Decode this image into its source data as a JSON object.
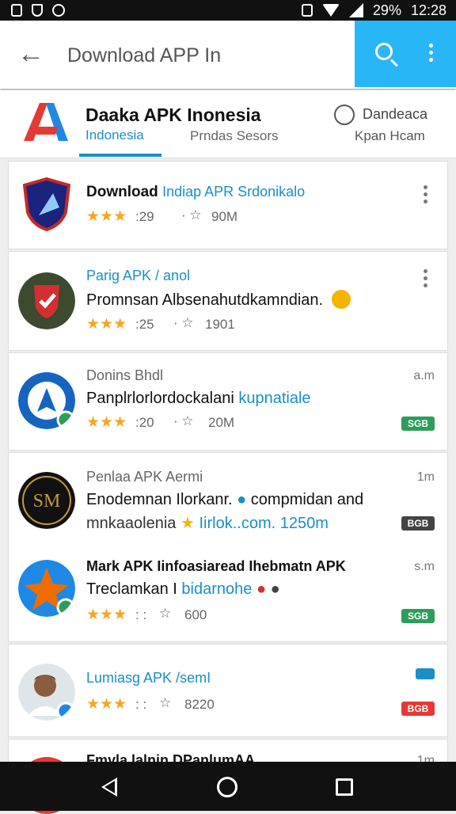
{
  "status_bar": {
    "battery": "29%",
    "time": "12:28"
  },
  "toolbar": {
    "search_text": "Download APP In",
    "back_icon": "arrow-left-icon",
    "search_icon": "search-icon",
    "menu_icon": "more-vert-icon",
    "accent": "#29b6f6"
  },
  "header": {
    "title": "Daaka APK Inonesia",
    "tab_active": "Indonesia",
    "tab_mid": "Prndas Sesors",
    "right_line1": "Dandeaca",
    "right_line2": "Kpan Hcam",
    "accent": "#1a8fc4"
  },
  "apps": [
    {
      "title_bold": "Download",
      "title_rest": "Indiap APR Srdonikalo",
      "stars": "★★★",
      "rating": ":29",
      "downloads": "90M"
    },
    {
      "title": "Parig APK / anol",
      "line": "Promnsan Albsenahutdkamndian.",
      "stars": "★★★",
      "rating": ":25",
      "downloads": "1901"
    },
    {
      "title": "Donins Bhdl",
      "line_a": "Panplrlorlordockalani",
      "line_b": "kupnatiale",
      "stars": "★★★",
      "rating": ":20",
      "downloads": "20M",
      "note": "a.m",
      "badge": "SGB"
    },
    {
      "title": "Penlaa APK Aermi",
      "line1": "Enodemnan Ilorkanr.",
      "line1b": "compmidan and",
      "line2": "mnkaaolenia",
      "line2b": "Iirlok..com.",
      "line2c": "1250m",
      "note": "1m",
      "badge": "BGB"
    },
    {
      "title": "Mark APK Iinfoasiaread Ihebmatn APK",
      "line": "Treclamkan I",
      "line_b": "bidarnohe",
      "stars": "★★★",
      "rating": ": :",
      "downloads": "600",
      "note": "s.m",
      "badge": "SGB"
    },
    {
      "title": "Lumiasg APK /semI",
      "stars": "★★★",
      "rating": ": :",
      "downloads": "8220",
      "badge": "BGB"
    },
    {
      "title": "Fmyla lalnin DPanlumAA",
      "note": "1m"
    }
  ],
  "nav": {
    "back_icon": "nav-back-icon",
    "home_icon": "nav-home-icon",
    "recent_icon": "nav-recent-icon"
  }
}
